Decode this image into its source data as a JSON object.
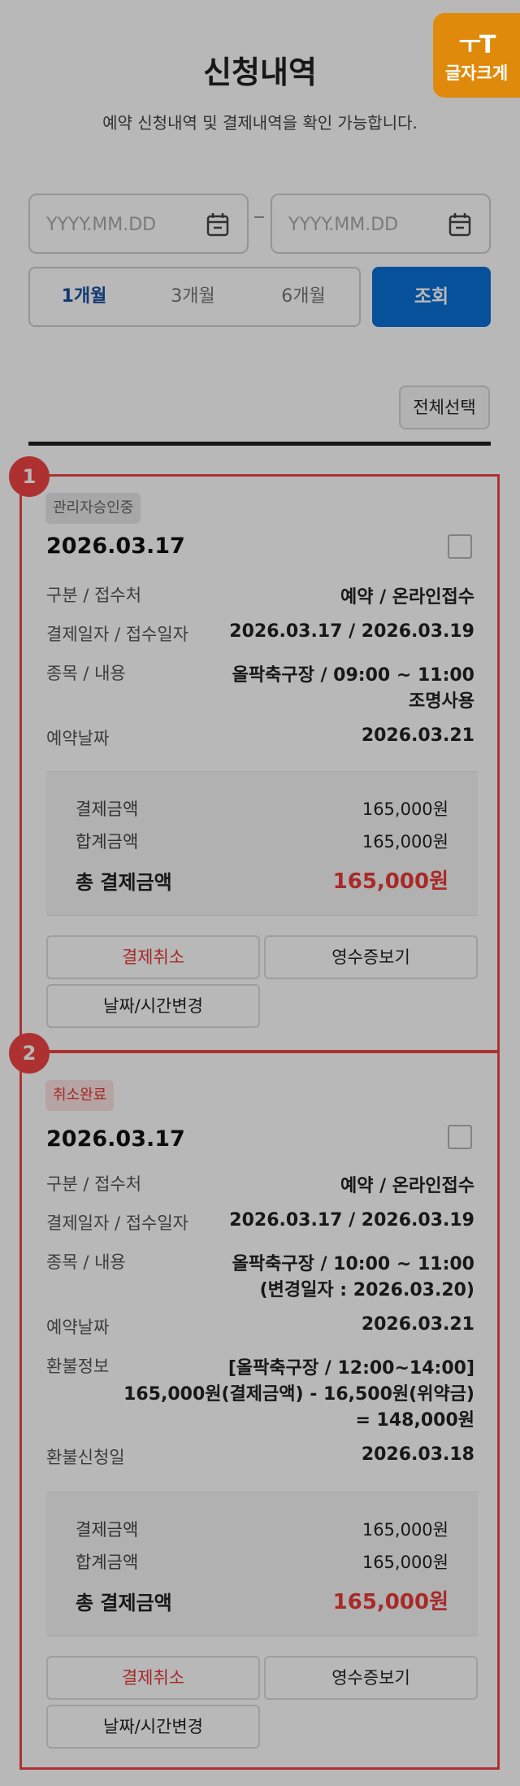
{
  "header": {
    "title": "신청내역",
    "subtitle": "예약 신청내역 및 결제내역을 확인 가능합니다.",
    "font_button_glyph": "ㅜT",
    "font_button_label": "글자크게"
  },
  "filters": {
    "start_placeholder": "YYYY.MM.DD",
    "end_placeholder": "YYYY.MM.DD",
    "periods": [
      "1개월",
      "3개월",
      "6개월"
    ],
    "active_period": "1개월",
    "search_label": "조회",
    "select_all_label": "전체선택"
  },
  "colors": {
    "accent": "#0a6fd6",
    "danger": "#ea3a3a",
    "highlight_border": "#f04444",
    "font_button": "#e08a0b"
  },
  "cards": [
    {
      "index": "1",
      "tag": "관리자승인중",
      "date": "2026.03.17",
      "rows": [
        {
          "label": "구분 / 접수처",
          "value": "예약 / 온라인접수"
        },
        {
          "label": "결제일자 / 접수일자",
          "value": "2026.03.17 / 2026.03.19"
        },
        {
          "label": "종목 / 내용",
          "value": "올팍축구장 / 09:00 ~ 11:00",
          "value2": "조명사용"
        },
        {
          "label": "예약날짜",
          "value": "2026.03.21"
        }
      ],
      "summary": {
        "pay_label": "결제금액",
        "pay_value": "165,000원",
        "sum_label": "합계금액",
        "sum_value": "165,000원",
        "total_label": "총 결제금액",
        "total_value": "165,000원"
      },
      "buttons": {
        "cancel": "결제취소",
        "receipt": "영수증보기",
        "change": "날짜/시간변경"
      }
    },
    {
      "index": "2",
      "tag": "취소완료",
      "date": "2026.03.17",
      "rows": [
        {
          "label": "구분 / 접수처",
          "value": "예약 / 온라인접수"
        },
        {
          "label": "결제일자 / 접수일자",
          "value": "2026.03.17 / 2026.03.19"
        },
        {
          "label": "종목 / 내용",
          "value": "올팍축구장 / 10:00 ~ 11:00",
          "value2": "(변경일자 : 2026.03.20)"
        },
        {
          "label": "예약날짜",
          "value": "2026.03.21"
        },
        {
          "label": "환불정보",
          "value": "[올팍축구장 / 12:00~14:00]",
          "value2": "165,000원(결제금액) - 16,500원(위약금)",
          "value3": "= 148,000원"
        },
        {
          "label": "환불신청일",
          "value": "2026.03.18"
        }
      ],
      "summary": {
        "pay_label": "결제금액",
        "pay_value": "165,000원",
        "sum_label": "합계금액",
        "sum_value": "165,000원",
        "total_label": "총 결제금액",
        "total_value": "165,000원"
      },
      "buttons": {
        "cancel": "결제취소",
        "receipt": "영수증보기",
        "change": "날짜/시간변경"
      }
    }
  ]
}
